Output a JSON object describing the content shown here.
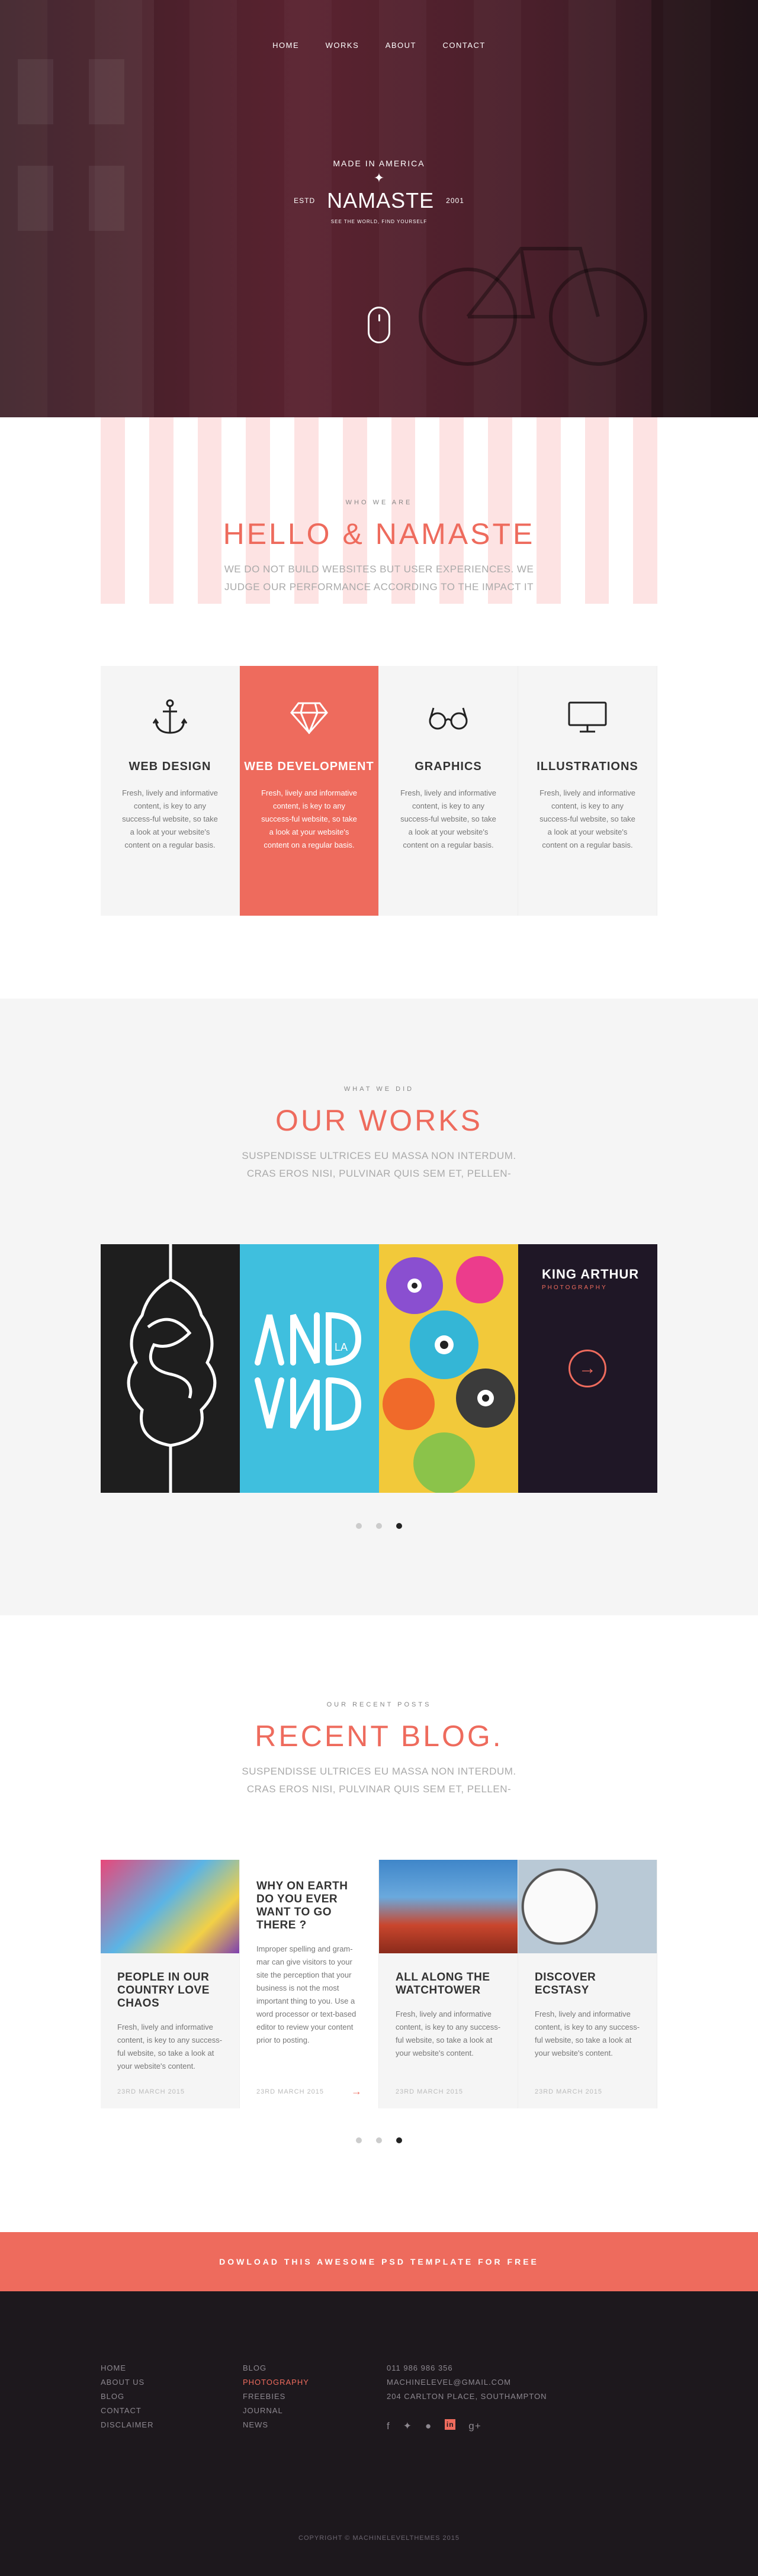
{
  "nav": {
    "items": [
      "HOME",
      "WORKS",
      "ABOUT",
      "CONTACT"
    ]
  },
  "logo": {
    "made": "MADE IN AMERICA",
    "estd": "ESTD",
    "name": "NAMASTE",
    "year": "2001",
    "tagline": "SEE THE WORLD, FIND YOURSELF"
  },
  "intro": {
    "eyebrow": "WHO WE ARE",
    "title": "HELLO & NAMASTE",
    "line1": "WE DO NOT BUILD WEBSITES BUT USER EXPERIENCES. WE",
    "line2": "JUDGE OUR PERFORMANCE ACCORDING TO THE IMPACT IT"
  },
  "services": [
    {
      "title": "WEB DESIGN",
      "text": "Fresh, lively and informative content, is key to any success-ful website, so take a look at your website's content on a regular basis.",
      "icon": "anchor-icon"
    },
    {
      "title": "WEB DEVELOPMENT",
      "text": "Fresh, lively and informative content, is key to any success-ful website, so take a look at your website's content on a regular basis.",
      "icon": "diamond-icon"
    },
    {
      "title": "GRAPHICS",
      "text": "Fresh, lively and informative content, is key to any success-ful website, so take a look at your website's content on a regular basis.",
      "icon": "glasses-icon"
    },
    {
      "title": "ILLUSTRATIONS",
      "text": "Fresh, lively and informative content, is key to any success-ful website, so take a look at your website's content on a regular basis.",
      "icon": "monitor-icon"
    }
  ],
  "works": {
    "eyebrow": "WHAT WE DID",
    "title": "OUR WORKS",
    "line1": "SUSPENDISSE ULTRICES EU MASSA NON INTERDUM.",
    "line2": "CRAS EROS NISI, PULVINAR QUIS SEM ET, PELLEN-",
    "featured_title": "KING ARTHUR",
    "featured_cat": "PHOTOGRAPHY",
    "art2_text": "LA"
  },
  "blog": {
    "eyebrow": "OUR RECENT POSTS",
    "title": "RECENT BLOG.",
    "line1": "SUSPENDISSE ULTRICES EU MASSA NON INTERDUM.",
    "line2": "CRAS EROS NISI, PULVINAR QUIS SEM ET, PELLEN-",
    "posts": [
      {
        "title": "PEOPLE IN OUR COUNTRY LOVE CHAOS",
        "text": "Fresh, lively and informative content, is key to any success-ful website, so take a look at your website's content.",
        "date": "23RD MARCH 2015"
      },
      {
        "title": "WHY ON EARTH DO YOU EVER WANT TO GO THERE ?",
        "text": "Improper spelling and gram-mar can give visitors to your site the perception that your business is not the most important thing to you. Use a word processor or text-based editor to review your content prior to posting.",
        "date": "23RD MARCH 2015"
      },
      {
        "title": "ALL ALONG THE WATCHTOWER",
        "text": "Fresh, lively and informative content, is key to any success-ful website, so take a look at your website's content.",
        "date": "23RD MARCH 2015"
      },
      {
        "title": "DISCOVER ECSTASY",
        "text": "Fresh, lively and informative content, is key to any success-ful website, so take a look at your website's content.",
        "date": "23RD MARCH 2015"
      }
    ]
  },
  "cta": "DOWLOAD THIS AWESOME PSD TEMPLATE FOR FREE",
  "footer": {
    "col1": [
      "HOME",
      "ABOUT US",
      "BLOG",
      "CONTACT",
      "DISCLAIMER"
    ],
    "col2": [
      "BLOG",
      "PHOTOGRAPHY",
      "FREEBIES",
      "JOURNAL",
      "NEWS"
    ],
    "phone": "011 986 986 356",
    "email": "MACHINELEVEL@GMAIL.COM",
    "address": "204 CARLTON PLACE, SOUTHAMPTON",
    "copyright": "COPYRIGHT © MACHINELEVELTHEMES 2015"
  },
  "colors": {
    "accent": "#ee6b5d",
    "footer": "#1d181d",
    "light_bg": "#f5f5f5"
  }
}
